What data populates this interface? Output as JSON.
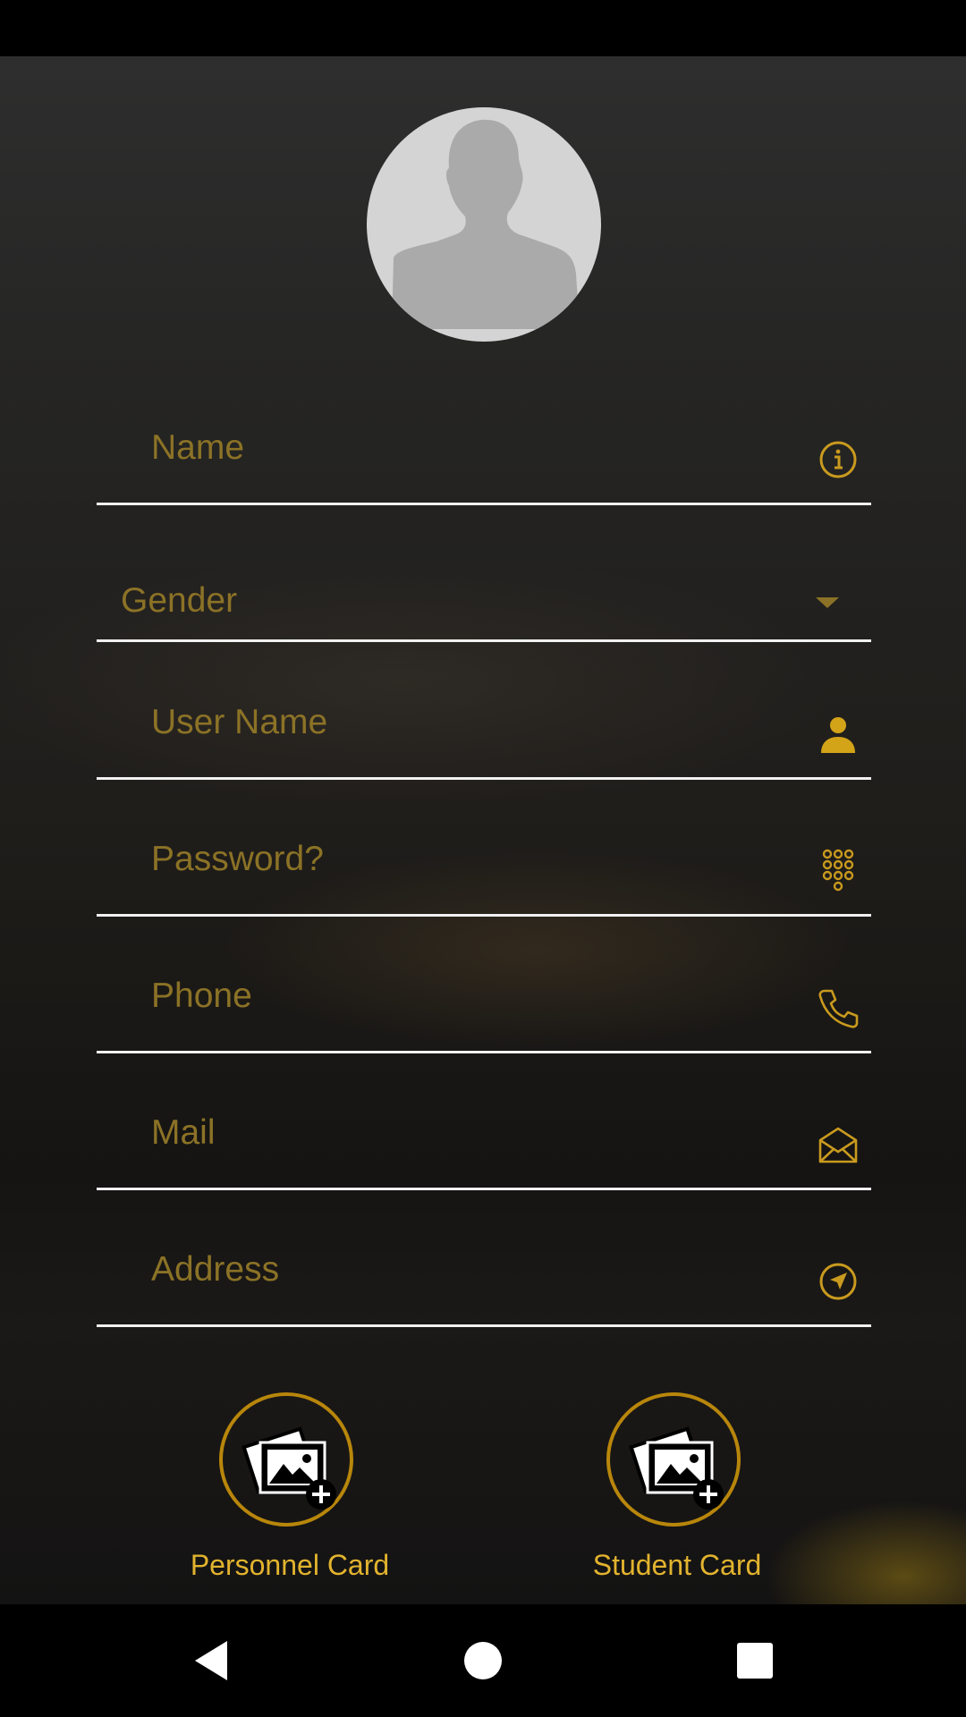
{
  "form": {
    "fields": [
      {
        "placeholder": "Name",
        "icon": "info-icon"
      },
      {
        "placeholder": "Gender",
        "icon": "dropdown-arrow-icon"
      },
      {
        "placeholder": "User Name",
        "icon": "person-icon"
      },
      {
        "placeholder": "Password?",
        "icon": "keypad-icon"
      },
      {
        "placeholder": "Phone",
        "icon": "phone-icon"
      },
      {
        "placeholder": "Mail",
        "icon": "mail-icon"
      },
      {
        "placeholder": "Address",
        "icon": "navigation-icon"
      }
    ]
  },
  "cards": [
    {
      "label": "Personnel Card",
      "icon": "add-photo-icon"
    },
    {
      "label": "Student Card",
      "icon": "add-photo-icon"
    }
  ],
  "avatar": {
    "icon": "profile-silhouette-icon"
  },
  "navigation": {
    "back": "back-triangle-icon",
    "home": "home-circle-icon",
    "recents": "recents-square-icon"
  },
  "colors": {
    "accent": "#b8860b",
    "label": "#8b7226",
    "card_label": "#e2b32e",
    "underline": "#f1f1f1",
    "avatar_bg": "#d4d4d4"
  }
}
